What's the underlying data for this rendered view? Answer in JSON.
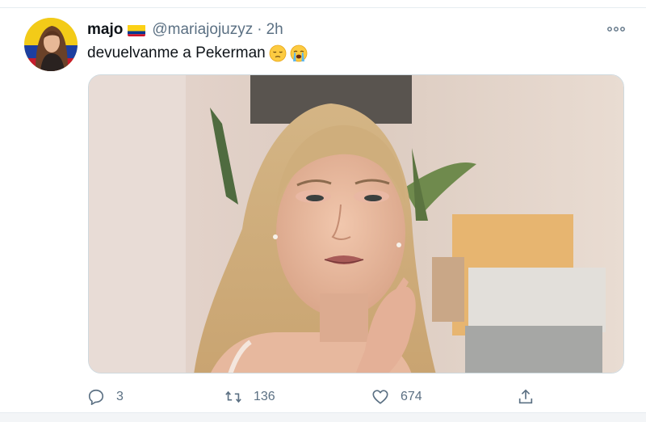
{
  "tweet": {
    "display_name": "majo",
    "handle": "@mariajojuzyz",
    "separator": "·",
    "time": "2h",
    "text": "devuelvanme a Pekerman",
    "emojis": [
      "pensive-face",
      "loudly-crying-face"
    ]
  },
  "author": {
    "flag": "colombia-flag",
    "flag_colors": [
      "#fcd116",
      "#003893",
      "#ce1126"
    ]
  },
  "actions": {
    "reply_count": "3",
    "retweet_count": "136",
    "like_count": "674"
  },
  "icons": [
    "more-icon",
    "reply-icon",
    "retweet-icon",
    "like-icon",
    "share-icon"
  ],
  "colors": {
    "text": "#0f1419",
    "muted": "#5b7083",
    "border": "#e6ecf0"
  }
}
